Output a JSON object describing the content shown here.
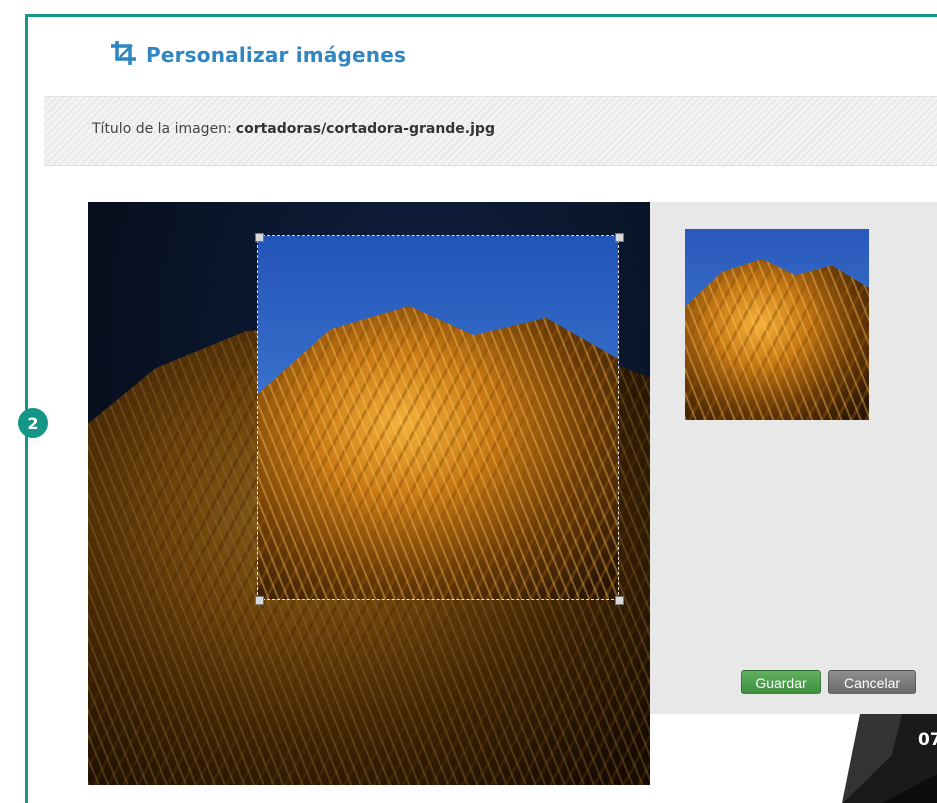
{
  "header": {
    "icon": "crop-icon",
    "title": "Personalizar imágenes"
  },
  "title_bar": {
    "label": "Título de la imagen:",
    "filename": "cortadoras/cortadora-grande.jpg"
  },
  "annotation": {
    "step_number": "2"
  },
  "editor": {
    "preview_label": "preview-thumbnail"
  },
  "actions": {
    "save_label": "Guardar",
    "cancel_label": "Cancelar"
  },
  "page": {
    "number": "07"
  },
  "colors": {
    "frame": "#149786",
    "title": "#2f86c0",
    "save_button": "#4a9d4a",
    "cancel_button": "#7a7a7a"
  }
}
